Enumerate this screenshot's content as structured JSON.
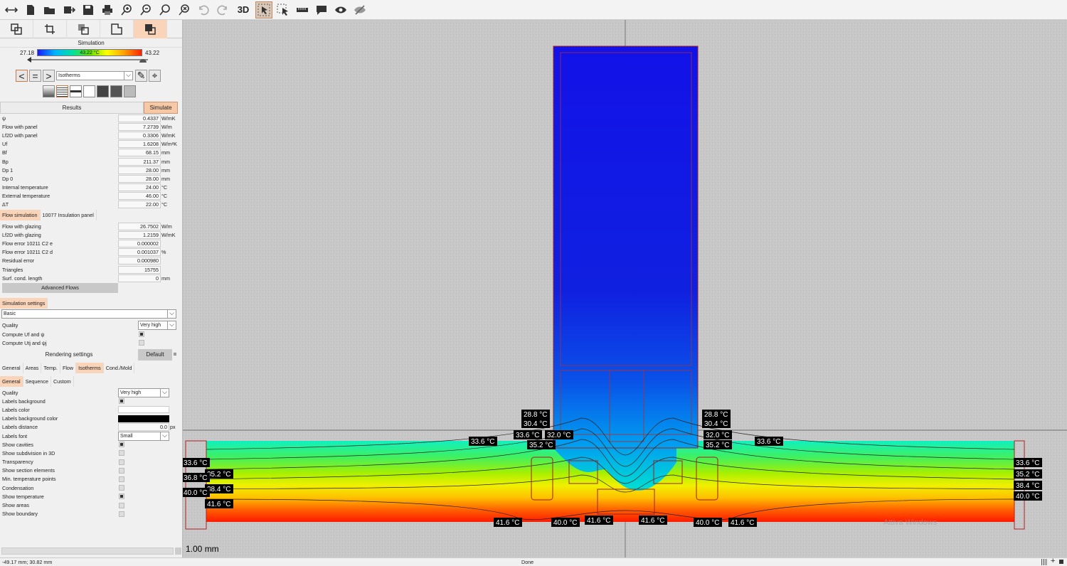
{
  "toolbar": {
    "icons": [
      "arrows-horizontal-icon",
      "new-file-icon",
      "open-folder-icon",
      "import-icon",
      "save-icon",
      "print-icon",
      "zoom-in-icon",
      "zoom-out-icon",
      "zoom-fit-icon",
      "zoom-reset-icon",
      "undo-icon",
      "redo-icon"
    ],
    "label_3d": "3D"
  },
  "panel": {
    "section_title": "Simulation",
    "legend": {
      "min": "27.18",
      "max": "43.22",
      "current": "43.22 °C"
    },
    "view_select": "Isotherms",
    "results_label": "Results",
    "simulate_label": "Simulate",
    "results": [
      {
        "label": "ψ",
        "value": "0.4337",
        "unit": "W/mK"
      },
      {
        "label": "Flow with panel",
        "value": "7.2739",
        "unit": "W/m"
      },
      {
        "label": "Lf2D with panel",
        "value": "0.3306",
        "unit": "W/mK"
      },
      {
        "label": "Uf",
        "value": "1.6208",
        "unit": "W/m²K"
      },
      {
        "label": "Bf",
        "value": "68.15",
        "unit": "mm"
      },
      {
        "label": "Bp",
        "value": "211.37",
        "unit": "mm"
      },
      {
        "label": "Dp 1",
        "value": "28.00",
        "unit": "mm"
      },
      {
        "label": "Dp 0",
        "value": "28.00",
        "unit": "mm"
      },
      {
        "label": "Internal temperature",
        "value": "24.00",
        "unit": "°C"
      },
      {
        "label": "External temperature",
        "value": "46.00",
        "unit": "°C"
      },
      {
        "label": "ΔT",
        "value": "22.00",
        "unit": "°C"
      }
    ],
    "flow_tabs": [
      "Flow simulation",
      "10077 Insulation panel"
    ],
    "flow": [
      {
        "label": "Flow with glazing",
        "value": "26.7502",
        "unit": "W/m"
      },
      {
        "label": "Lf2D with glazing",
        "value": "1.2159",
        "unit": "W/mK"
      },
      {
        "label": "Flow error 10211 C2 e",
        "value": "0.000002",
        "unit": ""
      },
      {
        "label": "Flow error 10211 C2 d",
        "value": "0.001037",
        "unit": "%"
      },
      {
        "label": "Residual error",
        "value": "0.000980",
        "unit": ""
      },
      {
        "label": "Triangles",
        "value": "15755",
        "unit": ""
      },
      {
        "label": "Surf. cond. length",
        "value": "0",
        "unit": "mm"
      }
    ],
    "advanced_flows": "Advanced Flows",
    "sim_settings_tab": "Simulation settings",
    "sim_preset": "Basic",
    "quality_label": "Quality",
    "quality_value": "Very high",
    "compute_uf": "Compute Uf and ψ",
    "compute_utj": "Compute Utj and ψj",
    "rendering_label": "Rendering settings",
    "default_label": "Default",
    "render_tabs": [
      "General",
      "Areas",
      "Temp.",
      "Flow",
      "Isotherms",
      "Cond./Mold"
    ],
    "iso_tabs": [
      "General",
      "Sequence",
      "Custom"
    ],
    "iso": {
      "quality_label": "Quality",
      "quality_value": "Very high",
      "labels_background": "Labels background",
      "labels_color": "Labels color",
      "labels_bg_color": "Labels background color",
      "labels_distance": "Labels distance",
      "labels_distance_value": "0.0",
      "labels_distance_unit": "px",
      "labels_font": "Labels font",
      "labels_font_value": "Small",
      "checks": [
        {
          "label": "Show cavities",
          "on": true
        },
        {
          "label": "Show subdivision in 3D",
          "on": false
        },
        {
          "label": "Transparency",
          "on": false
        },
        {
          "label": "Show section elements",
          "on": false
        },
        {
          "label": "Min. temperature points",
          "on": false
        },
        {
          "label": "Condensation",
          "on": false
        },
        {
          "label": "Show temperature",
          "on": true
        },
        {
          "label": "Show areas",
          "on": false
        },
        {
          "label": "Show boundary",
          "on": false
        }
      ]
    }
  },
  "canvas": {
    "scale_label": "1.00 mm",
    "watermark": "Attiva Windows",
    "isotherm_labels": {
      "upper": [
        "28.8 °C",
        "30.4 °C",
        "33.6 °C",
        "32.0 °C",
        "35.2 °C",
        "28.8 °C",
        "30.4 °C",
        "32.0 °C",
        "35.2 °C",
        "33.6 °C",
        "33.6 °C"
      ],
      "left": [
        "33.6 °C",
        "35.2 °C",
        "36.8 °C",
        "38.4 °C",
        "40.0 °C",
        "41.6 °C"
      ],
      "right": [
        "33.6 °C",
        "35.2 °C",
        "38.4 °C",
        "40.0 °C"
      ],
      "bottom": [
        "41.6 °C",
        "40.0 °C",
        "41.6 °C",
        "41.6 °C",
        "40.0 °C",
        "41.6 °C"
      ]
    }
  },
  "status": {
    "coords": "-49.17 mm; 30.82 mm",
    "state": "Done"
  }
}
